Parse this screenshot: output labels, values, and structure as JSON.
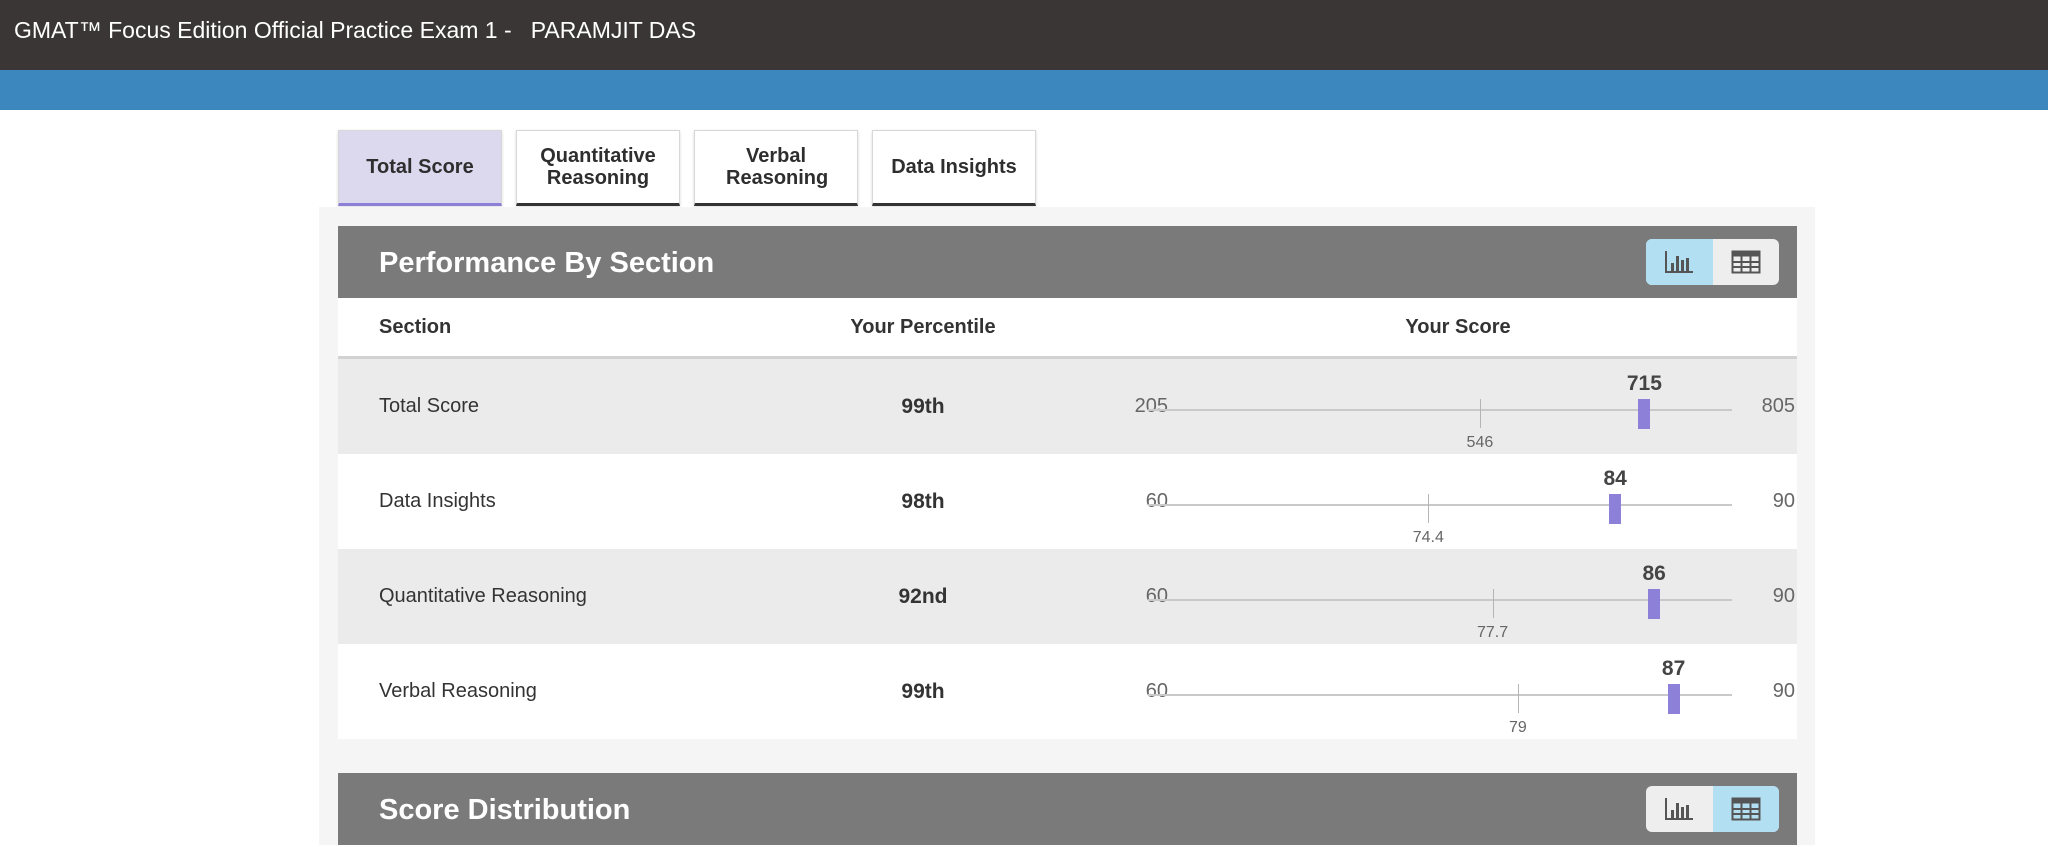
{
  "window": {
    "title": "GMAT™ Focus Edition Official Practice Exam 1 -   PARAMJIT DAS"
  },
  "tabs": [
    {
      "label": "Total Score",
      "active": true
    },
    {
      "label": "Quantitative Reasoning",
      "active": false
    },
    {
      "label": "Verbal Reasoning",
      "active": false
    },
    {
      "label": "Data Insights",
      "active": false
    }
  ],
  "performance": {
    "title": "Performance By Section",
    "view_selected": "chart",
    "view_icons": [
      "bar-chart-icon",
      "table-grid-icon"
    ],
    "columns": {
      "section": "Section",
      "percentile": "Your Percentile",
      "score": "Your Score"
    },
    "rows": [
      {
        "section": "Total Score",
        "percentile": "99th",
        "min": 205,
        "max": 805,
        "average": 546,
        "score": 715
      },
      {
        "section": "Data Insights",
        "percentile": "98th",
        "min": 60,
        "max": 90,
        "average": 74.4,
        "score": 84
      },
      {
        "section": "Quantitative Reasoning",
        "percentile": "92nd",
        "min": 60,
        "max": 90,
        "average": 77.7,
        "score": 86
      },
      {
        "section": "Verbal Reasoning",
        "percentile": "99th",
        "min": 60,
        "max": 90,
        "average": 79,
        "score": 87
      }
    ]
  },
  "distribution": {
    "title": "Score Distribution",
    "view_selected": "table"
  },
  "colors": {
    "titlebar": "#3a3636",
    "accent_bar": "#3c88be",
    "panel_header": "#7a7a7a",
    "active_tab": "#dcd9ef",
    "score_marker": "#8c80d8",
    "toggle_active": "#b3dff2"
  }
}
